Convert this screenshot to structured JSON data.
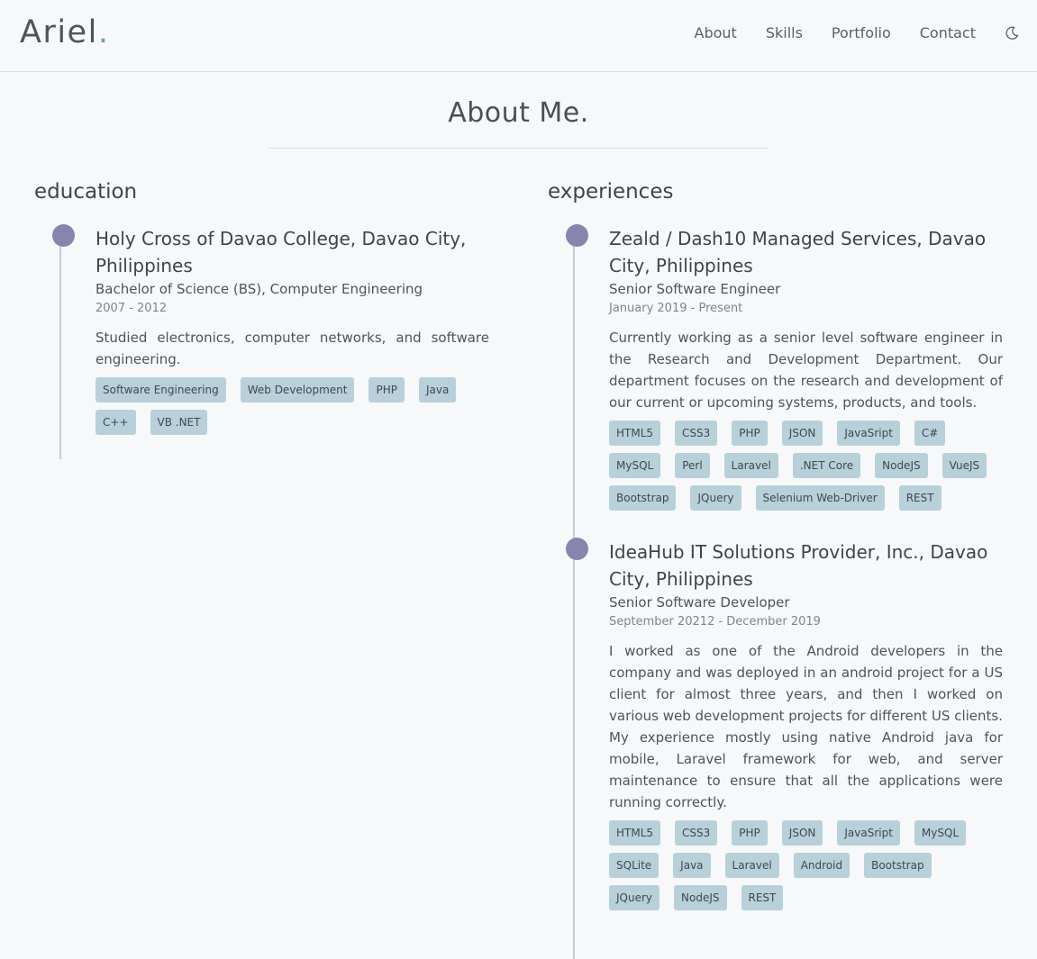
{
  "header": {
    "logo": "Ariel",
    "logo_dot": ".",
    "nav": [
      "About",
      "Skills",
      "Portfolio",
      "Contact"
    ],
    "theme_toggle_icon": "moon-icon"
  },
  "page_title": "About Me.",
  "education": {
    "heading": "education",
    "entries": [
      {
        "school": "Holy Cross of Davao College, Davao City, Philippines",
        "degree": "Bachelor of Science (BS), Computer Engineering",
        "date": "2007 - 2012",
        "description": "Studied electronics, computer networks, and software engineering.",
        "tags": [
          "Software Engineering",
          "Web Development",
          "PHP",
          "Java",
          "C++",
          "VB .NET"
        ]
      }
    ]
  },
  "experiences": {
    "heading": "experiences",
    "entries": [
      {
        "company": "Zeald / Dash10 Managed Services, Davao City, Philippines",
        "role": "Senior Software Engineer",
        "date": "January 2019 - Present",
        "description": "Currently working as a senior level software engineer in the Research and Development Department. Our department focuses on the research and development of our current or upcoming systems, products, and tools.",
        "tags": [
          "HTML5",
          "CSS3",
          "PHP",
          "JSON",
          "JavaSript",
          "C#",
          "MySQL",
          "Perl",
          "Laravel",
          ".NET Core",
          "NodeJS",
          "VueJS",
          "Bootstrap",
          "JQuery",
          "Selenium Web-Driver",
          "REST"
        ]
      },
      {
        "company": "IdeaHub IT Solutions Provider, Inc., Davao City, Philippines",
        "role": "Senior Software Developer",
        "date": "September 20212 - December 2019",
        "description": "I worked as one of the Android developers in the company and was deployed in an android project for a US client for almost three years, and then I worked on various web development projects for different US clients. My experience mostly using native Android java for mobile, Laravel framework for web, and server maintenance to ensure that all the applications were running correctly.",
        "tags": [
          "HTML5",
          "CSS3",
          "PHP",
          "JSON",
          "JavaSript",
          "MySQL",
          "SQLite",
          "Java",
          "Laravel",
          "Android",
          "Bootstrap",
          "JQuery",
          "NodeJS",
          "REST"
        ]
      }
    ]
  },
  "colors": {
    "bullet": "#8585ad",
    "tag_bg": "#b8d0da",
    "logo_dot": "#6f9bb8"
  }
}
